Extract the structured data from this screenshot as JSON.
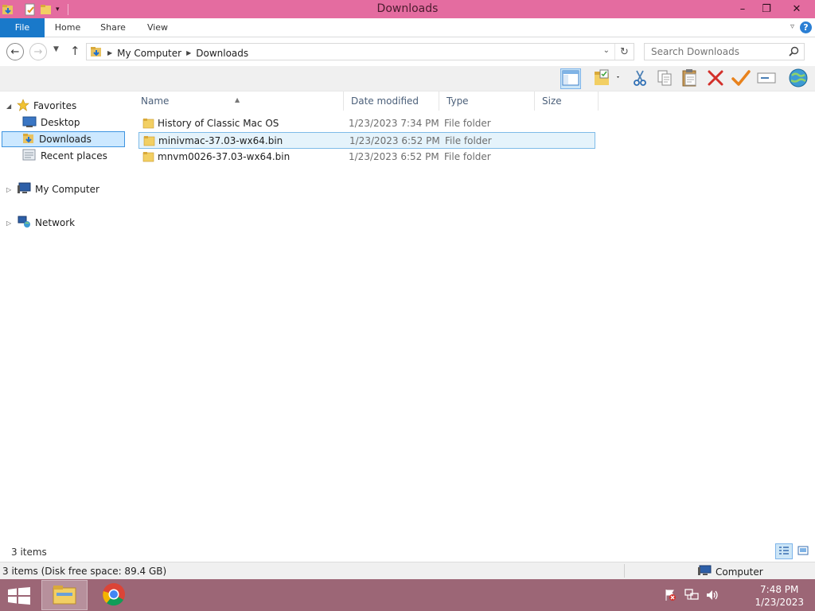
{
  "window": {
    "title": "Downloads",
    "controls": {
      "minimize": "–",
      "maximize": "❐",
      "close": "✕"
    }
  },
  "ribbon": {
    "tabs": [
      {
        "label": "File"
      },
      {
        "label": "Home"
      },
      {
        "label": "Share"
      },
      {
        "label": "View"
      }
    ],
    "help_label": "?"
  },
  "address": {
    "breadcrumb": [
      "My Computer",
      "Downloads"
    ]
  },
  "search": {
    "placeholder": "Search Downloads"
  },
  "toolbar": {
    "icons": [
      "preview-pane-icon",
      "new-folder-icon",
      "cut-icon",
      "copy-icon",
      "paste-icon",
      "delete-icon",
      "properties-check-icon",
      "rename-icon",
      "globe-icon"
    ]
  },
  "navpane": {
    "favorites": "Favorites",
    "items": [
      {
        "label": "Desktop"
      },
      {
        "label": "Downloads"
      },
      {
        "label": "Recent places"
      }
    ],
    "computer": "My Computer",
    "network": "Network"
  },
  "columns": {
    "name": "Name",
    "date": "Date modified",
    "type": "Type",
    "size": "Size"
  },
  "files": [
    {
      "name": "History of Classic Mac OS",
      "date": "1/23/2023 7:34 PM",
      "type": "File folder",
      "size": ""
    },
    {
      "name": "minivmac-37.03-wx64.bin",
      "date": "1/23/2023 6:52 PM",
      "type": "File folder",
      "size": ""
    },
    {
      "name": "mnvm0026-37.03-wx64.bin",
      "date": "1/23/2023 6:52 PM",
      "type": "File folder",
      "size": ""
    }
  ],
  "status": {
    "item_count": "3 items",
    "details": "3 items (Disk free space: 89.4 GB)",
    "location": "Computer"
  },
  "clock": {
    "time": "7:48 PM",
    "date": "1/23/2023"
  },
  "colors": {
    "titlebar": "#e46ca0",
    "file_tab": "#1979ca",
    "selection": "#e5f3fb",
    "taskbar": "#9c6676"
  }
}
